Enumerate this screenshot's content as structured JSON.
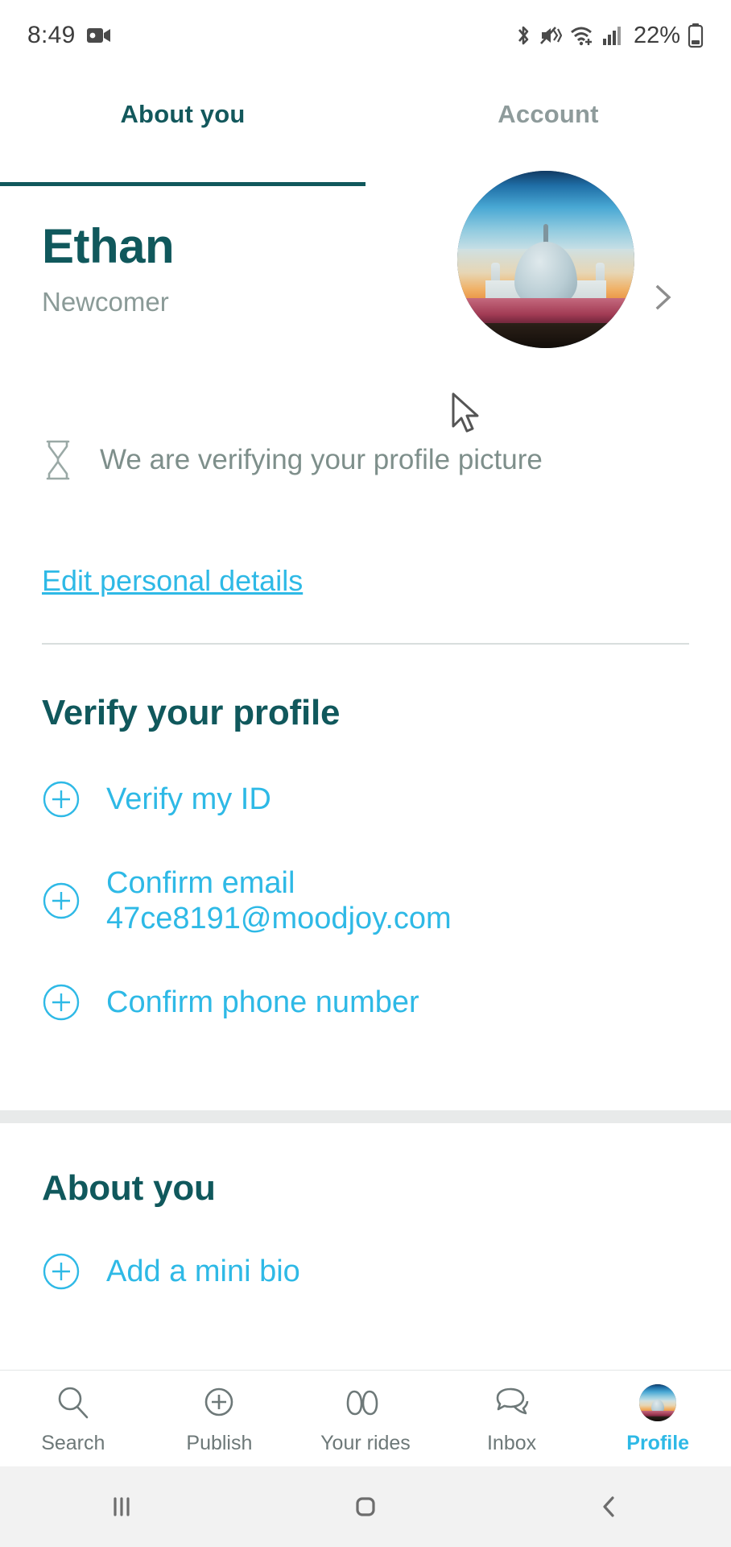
{
  "statusbar": {
    "time": "8:49",
    "battery_percent": "22%",
    "icons": [
      "video-recording-icon",
      "bluetooth-icon",
      "mute-vibrate-icon",
      "wifi-calling-icon",
      "cellular-signal-icon",
      "battery-icon"
    ]
  },
  "tabs": [
    {
      "label": "About you",
      "active": true
    },
    {
      "label": "Account",
      "active": false
    }
  ],
  "identity": {
    "name": "Ethan",
    "membership_level": "Newcomer",
    "avatar_alt": "taj-mahal-profile-photo",
    "chevron": "chevron-right-icon"
  },
  "verification_notice": {
    "icon": "hourglass-icon",
    "text": "We are verifying your profile picture"
  },
  "edit_link": "Edit personal details",
  "sections": [
    {
      "title": "Verify your profile",
      "items": [
        {
          "icon": "plus-circle-icon",
          "label": "Verify my ID"
        },
        {
          "icon": "plus-circle-icon",
          "label": "Confirm email 47ce8191@moodjoy.com"
        },
        {
          "icon": "plus-circle-icon",
          "label": "Confirm phone number"
        }
      ]
    },
    {
      "title": "About you",
      "items": [
        {
          "icon": "plus-circle-icon",
          "label": "Add a mini bio"
        }
      ]
    }
  ],
  "bottom_nav": [
    {
      "label": "Search",
      "icon": "search-icon",
      "active": false
    },
    {
      "label": "Publish",
      "icon": "plus-circle-icon",
      "active": false
    },
    {
      "label": "Your rides",
      "icon": "rides-icon",
      "active": false
    },
    {
      "label": "Inbox",
      "icon": "chat-bubbles-icon",
      "active": false
    },
    {
      "label": "Profile",
      "icon": "avatar-icon",
      "active": true
    }
  ],
  "android_nav": [
    {
      "name": "recents-button",
      "glyph": "|||"
    },
    {
      "name": "home-button",
      "glyph": "▢"
    },
    {
      "name": "back-button",
      "glyph": "‹"
    }
  ],
  "colors": {
    "brand_teal": "#10585c",
    "link_cyan": "#2eb9e6",
    "muted": "#8a9a97"
  }
}
